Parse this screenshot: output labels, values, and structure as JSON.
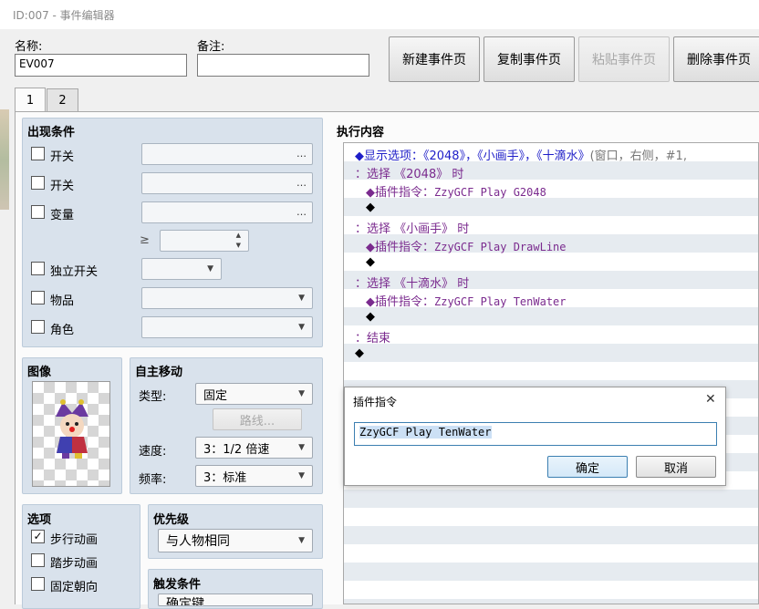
{
  "window": {
    "title": "ID:007 - 事件编辑器"
  },
  "header": {
    "name_label": "名称:",
    "name_value": "EV007",
    "note_label": "备注:",
    "note_value": ""
  },
  "toolbar": {
    "new_page": "新建事件页",
    "copy_page": "复制事件页",
    "paste_page": "粘贴事件页",
    "delete_page": "删除事件页"
  },
  "tabs": [
    "1",
    "2"
  ],
  "conditions": {
    "title": "出现条件",
    "switch1": "开关",
    "switch2": "开关",
    "variable": "变量",
    "ge_symbol": "≥",
    "self_switch": "独立开关",
    "item": "物品",
    "actor": "角色",
    "dots": "…"
  },
  "image": {
    "title": "图像"
  },
  "movement": {
    "title": "自主移动",
    "type_label": "类型:",
    "type_value": "固定",
    "route_button": "路线...",
    "speed_label": "速度:",
    "speed_value": "3：1/2 倍速",
    "freq_label": "频率:",
    "freq_value": "3：标准"
  },
  "options": {
    "title": "选项",
    "walk_anim": "步行动画",
    "step_anim": "踏步动画",
    "fixed_dir": "固定朝向",
    "walk_checked": "✓"
  },
  "priority": {
    "title": "优先级",
    "value": "与人物相同"
  },
  "trigger": {
    "title": "触发条件",
    "value": "确定键"
  },
  "content": {
    "title": "执行内容",
    "lines": {
      "show_choices": "◆显示选项：《2048》，《小画手》，《十滴水》",
      "show_choices_params": "(窗口，右侧，#1,",
      "when1": "：选择 《2048》 时",
      "plugin_label": "◆插件指令：",
      "plugin1": "ZzyGCF Play G2048",
      "diamond": "◆",
      "when2": "：选择 《小画手》 时",
      "plugin2": "ZzyGCF Play DrawLine",
      "when3": "：选择 《十滴水》 时",
      "plugin3": "ZzyGCF Play TenWater",
      "end": "：结束"
    }
  },
  "dialog": {
    "title": "插件指令",
    "close": "✕",
    "input_value": "ZzyGCF Play TenWater",
    "ok": "确定",
    "cancel": "取消"
  },
  "colors": {
    "group_bg": "#d9e2ec",
    "list_stripe": "#e6ebf0",
    "command_blue": "#1e1ec8",
    "command_purple": "#7a2a8e",
    "primary_button": "#d4e8f8"
  }
}
